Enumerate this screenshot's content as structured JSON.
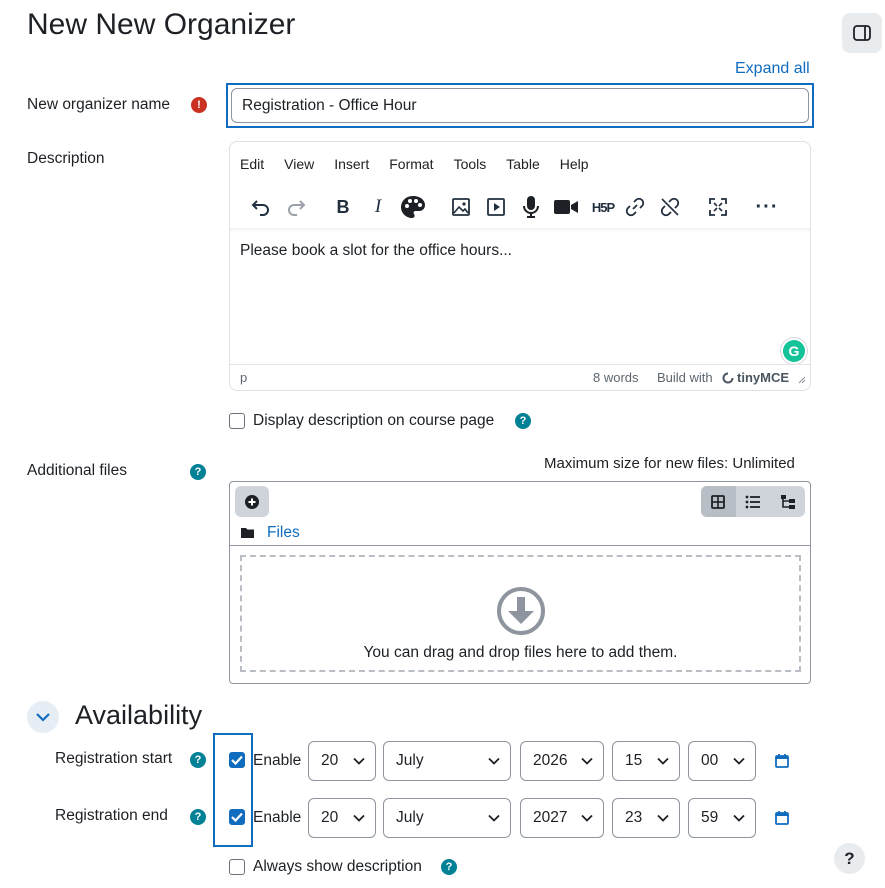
{
  "page": {
    "title": "New New Organizer",
    "expand_all": "Expand all"
  },
  "fields": {
    "name_label": "New organizer name",
    "name_value": "Registration - Office Hour",
    "description_label": "Description",
    "display_description_label": "Display description on course page",
    "additional_files_label": "Additional files",
    "max_size": "Maximum size for new files: Unlimited",
    "always_show_description_label": "Always show description"
  },
  "editor": {
    "menu": [
      "Edit",
      "View",
      "Insert",
      "Format",
      "Tools",
      "Table",
      "Help"
    ],
    "toolbar_icons": [
      "undo-icon",
      "redo-icon",
      "bold-icon",
      "italic-icon",
      "palette-icon",
      "image-icon",
      "media-icon",
      "microphone-icon",
      "video-icon",
      "h5p-icon",
      "link-icon",
      "unlink-icon",
      "fullscreen-icon",
      "more-icon"
    ],
    "content": "Please book a slot for the office hours...",
    "status_path": "p",
    "word_count": "8 words",
    "build_with": "Build with",
    "brand": "tinyMCE",
    "h5p_label": "H5P",
    "grammarly_letter": "G"
  },
  "files": {
    "folder_label": "Files",
    "drop_text": "You can drag and drop files here to add them."
  },
  "availability": {
    "section_title": "Availability",
    "enable_label": "Enable",
    "registration_start": {
      "label": "Registration start",
      "enabled": true,
      "day": "20",
      "month": "July",
      "year": "2026",
      "hour": "15",
      "minute": "00"
    },
    "registration_end": {
      "label": "Registration end",
      "enabled": true,
      "day": "20",
      "month": "July",
      "year": "2027",
      "hour": "23",
      "minute": "59"
    }
  },
  "help_fab": "?",
  "colors": {
    "accent": "#0f6cbf",
    "required": "#ca3120",
    "help": "#008196"
  }
}
